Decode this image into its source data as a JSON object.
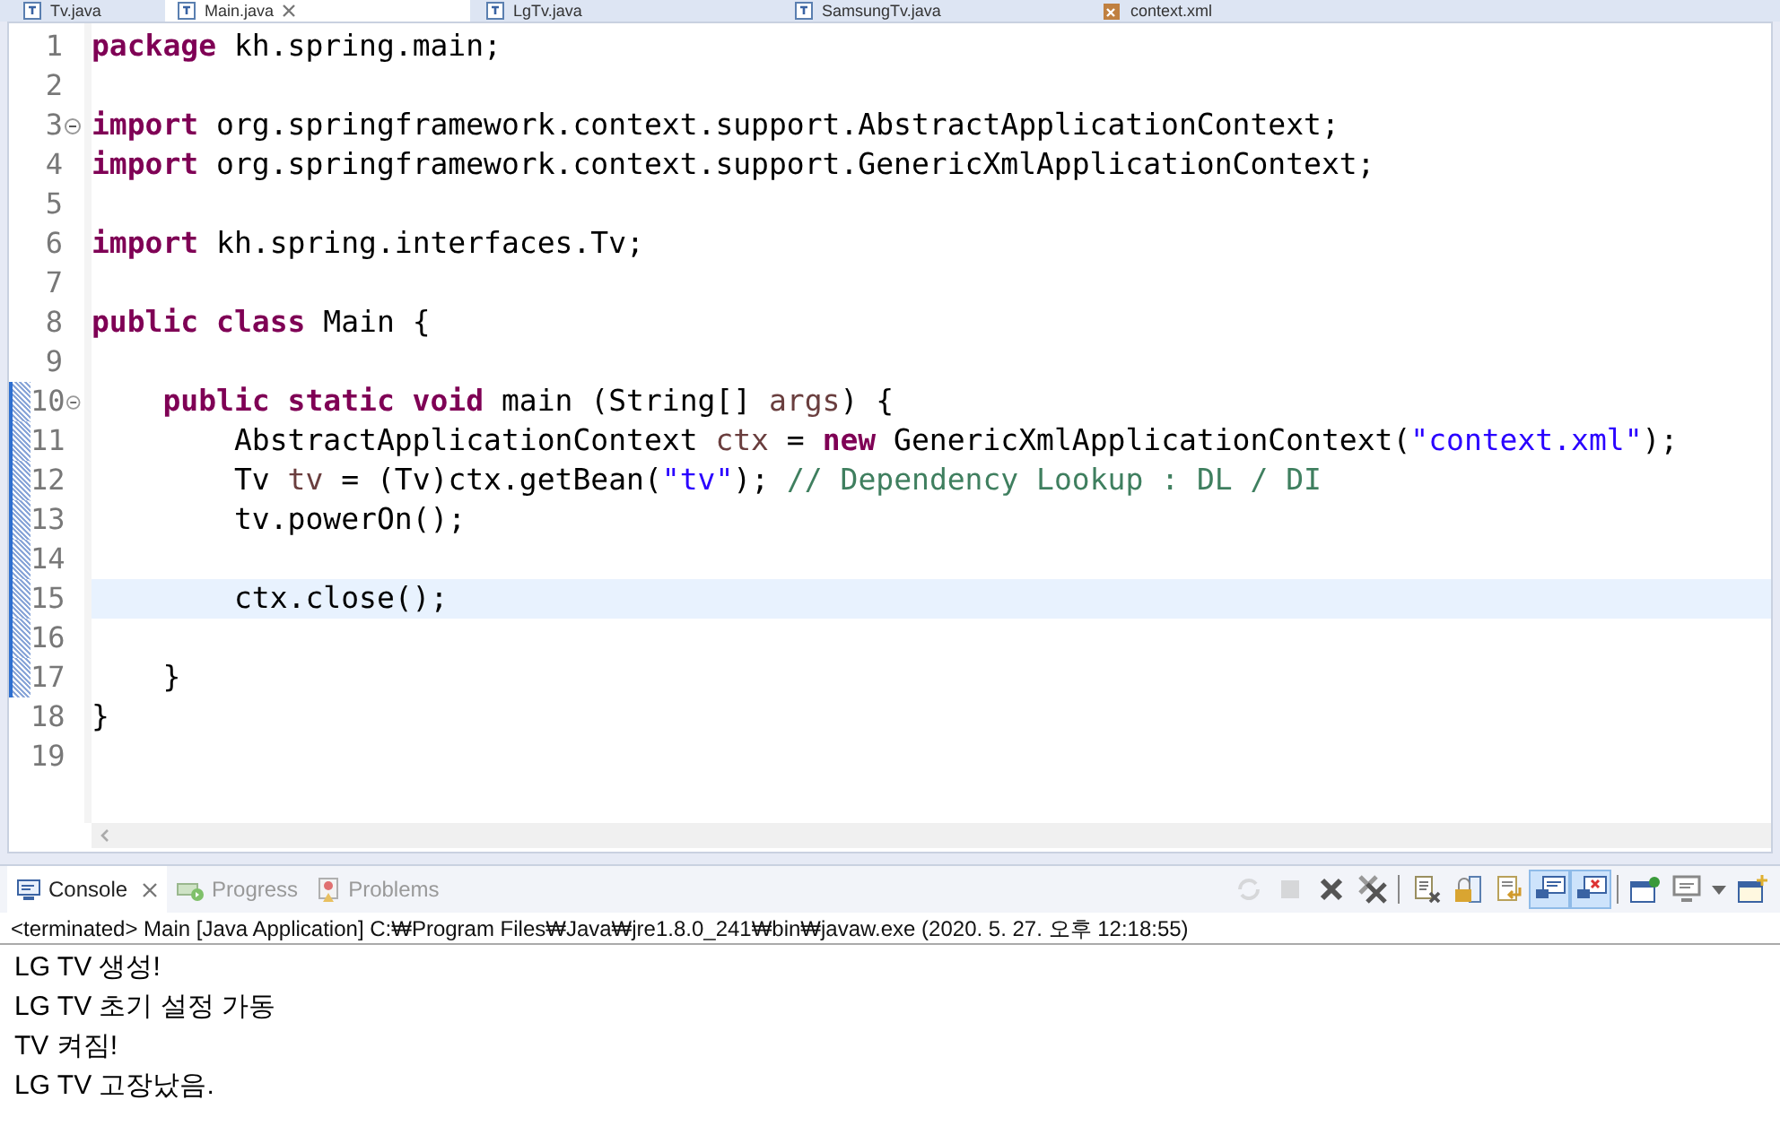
{
  "editor_tabs": [
    {
      "label": "Tv.java",
      "selected": false,
      "kind": "java"
    },
    {
      "label": "Main.java",
      "selected": true,
      "kind": "java"
    },
    {
      "label": "LgTv.java",
      "selected": false,
      "kind": "java"
    },
    {
      "label": "SamsungTv.java",
      "selected": false,
      "kind": "java"
    },
    {
      "label": "context.xml",
      "selected": false,
      "kind": "xml"
    }
  ],
  "code_lines": [
    {
      "number": "1",
      "tokens": [
        {
          "kind": "keyword",
          "text": "package"
        },
        {
          "kind": "plain",
          "text": " kh.spring.main;"
        }
      ]
    },
    {
      "number": "2"
    },
    {
      "number": "3",
      "folded": false,
      "tokens": [
        {
          "kind": "keyword",
          "text": "import"
        },
        {
          "kind": "plain",
          "text": " org.springframework.context.support.AbstractApplicationContext;"
        }
      ]
    },
    {
      "number": "4",
      "tokens": [
        {
          "kind": "keyword",
          "text": "import"
        },
        {
          "kind": "plain",
          "text": " org.springframework.context.support.GenericXmlApplicationContext;"
        }
      ]
    },
    {
      "number": "5"
    },
    {
      "number": "6",
      "tokens": [
        {
          "kind": "keyword",
          "text": "import"
        },
        {
          "kind": "plain",
          "text": " kh.spring.interfaces.Tv;"
        }
      ]
    },
    {
      "number": "7"
    },
    {
      "number": "8",
      "tokens": [
        {
          "kind": "keyword",
          "text": "public class"
        },
        {
          "kind": "plain",
          "text": " Main {"
        }
      ]
    },
    {
      "number": "9"
    },
    {
      "number": "10",
      "folded": false,
      "changed": true,
      "tokens": [
        {
          "kind": "keyword",
          "text": "    public static void"
        },
        {
          "kind": "plain",
          "text": " main (String[] "
        },
        {
          "kind": "param",
          "text": "args"
        },
        {
          "kind": "plain",
          "text": ") {"
        }
      ]
    },
    {
      "number": "11",
      "changed": true,
      "tokens": [
        {
          "kind": "plain",
          "text": "        AbstractApplicationContext "
        },
        {
          "kind": "local",
          "text": "ctx"
        },
        {
          "kind": "plain",
          "text": " = "
        },
        {
          "kind": "keyword",
          "text": "new"
        },
        {
          "kind": "plain",
          "text": " GenericXmlApplicationContext("
        },
        {
          "kind": "string",
          "text": "\"context.xml\""
        },
        {
          "kind": "plain",
          "text": ");"
        }
      ]
    },
    {
      "number": "12",
      "changed": true,
      "tokens": [
        {
          "kind": "plain",
          "text": "        Tv "
        },
        {
          "kind": "local",
          "text": "tv"
        },
        {
          "kind": "plain",
          "text": " = (Tv)ctx.getBean("
        },
        {
          "kind": "string",
          "text": "\"tv\""
        },
        {
          "kind": "plain",
          "text": "); "
        },
        {
          "kind": "comment",
          "text": "// Dependency Lookup : DL / DI"
        }
      ]
    },
    {
      "number": "13",
      "changed": true,
      "tokens": [
        {
          "kind": "plain",
          "text": "        tv.powerOn();"
        }
      ]
    },
    {
      "number": "14",
      "changed": true
    },
    {
      "number": "15",
      "changed": true,
      "current": true,
      "tokens": [
        {
          "kind": "plain",
          "text": "        ctx.close();"
        }
      ]
    },
    {
      "number": "16",
      "changed": true
    },
    {
      "number": "17",
      "changed": true,
      "tokens": [
        {
          "kind": "plain",
          "text": "    }"
        }
      ]
    },
    {
      "number": "18",
      "tokens": [
        {
          "kind": "plain",
          "text": "}"
        }
      ]
    },
    {
      "number": "19"
    }
  ],
  "console_tabs": [
    {
      "label": "Console",
      "selected": true,
      "kind": "console"
    },
    {
      "label": "Progress",
      "selected": false,
      "kind": "progress"
    },
    {
      "label": "Problems",
      "selected": false,
      "kind": "problems"
    }
  ],
  "console_toolbar": [
    {
      "kind": "sync",
      "disabled": true,
      "selected": false
    },
    {
      "kind": "stop",
      "disabled": true,
      "selected": false
    },
    {
      "kind": "remove",
      "disabled": false,
      "selected": false
    },
    {
      "kind": "remove-all",
      "disabled": false,
      "selected": false
    },
    {
      "kind": "clear",
      "disabled": false,
      "selected": false
    },
    {
      "kind": "lock",
      "disabled": false,
      "selected": false
    },
    {
      "kind": "word-wrap",
      "disabled": false,
      "selected": false
    },
    {
      "kind": "show-out",
      "disabled": false,
      "selected": true
    },
    {
      "kind": "show-err",
      "disabled": false,
      "selected": true
    },
    {
      "kind": "pin",
      "disabled": false,
      "selected": false
    },
    {
      "kind": "display",
      "disabled": false,
      "selected": false
    },
    {
      "kind": "new",
      "disabled": false,
      "selected": false
    }
  ],
  "console_status": "<terminated> Main [Java Application] C:₩Program Files₩Java₩jre1.8.0_241₩bin₩javaw.exe (2020. 5. 27. 오후 12:18:55)",
  "console_output": [
    "LG TV 생성!",
    "LG TV 초기 설정 가동",
    "TV 켜짐!",
    "LG TV 고장났음."
  ]
}
